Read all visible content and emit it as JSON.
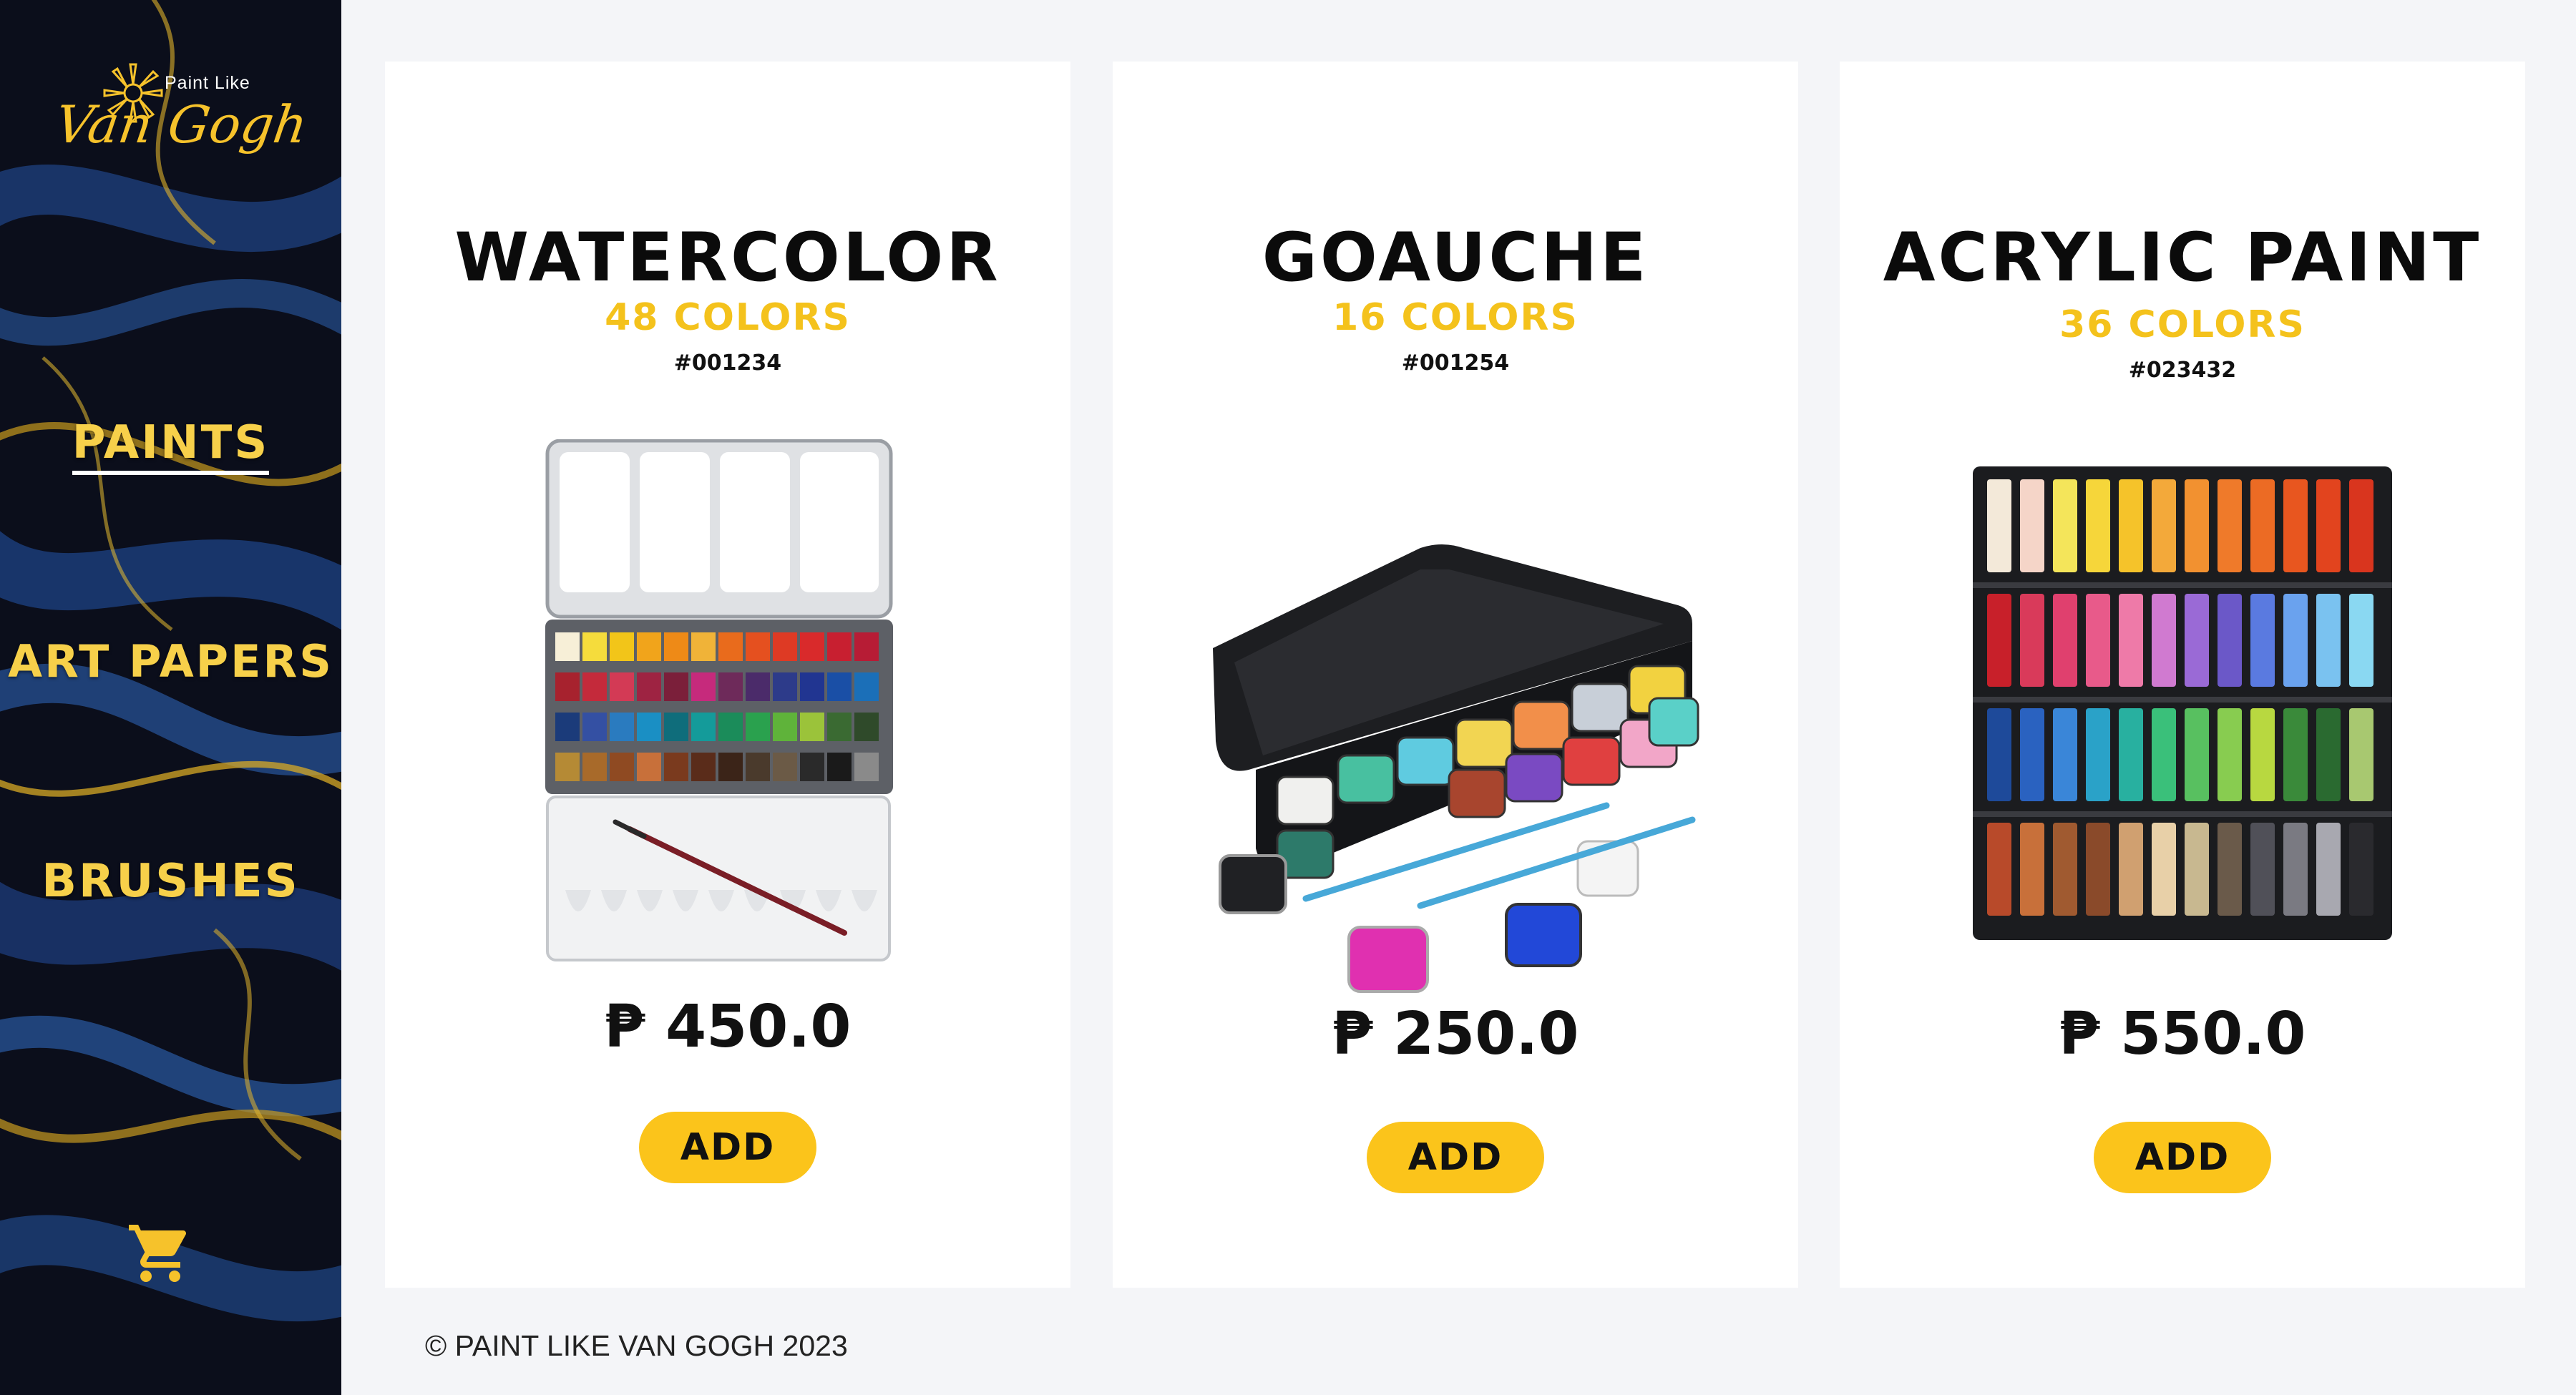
{
  "brand": {
    "small": "Paint Like",
    "script": "Van Gogh"
  },
  "nav": {
    "items": [
      {
        "label": "PAINTS",
        "active": true
      },
      {
        "label": "ART PAPERS",
        "active": false
      },
      {
        "label": "BRUSHES",
        "active": false
      }
    ],
    "cart_icon": "cart-icon"
  },
  "products": [
    {
      "name": "WATERCOLOR",
      "colors": "48 COLORS",
      "sku": "#001234",
      "price": "₱ 450.0",
      "add_label": "ADD"
    },
    {
      "name": "GOAUCHE",
      "colors": "16 COLORS",
      "sku": "#001254",
      "price": "₱ 250.0",
      "add_label": "ADD"
    },
    {
      "name": "ACRYLIC PAINT",
      "colors": "36 COLORS",
      "sku": "#023432",
      "price": "₱ 550.0",
      "add_label": "ADD"
    }
  ],
  "footer": {
    "text": "© PAINT LIKE VAN GOGH 2023"
  },
  "theme": {
    "accent": "#fbc41b",
    "nav_text": "#f7d04a",
    "background": "#f4f5f8",
    "card": "#ffffff"
  }
}
